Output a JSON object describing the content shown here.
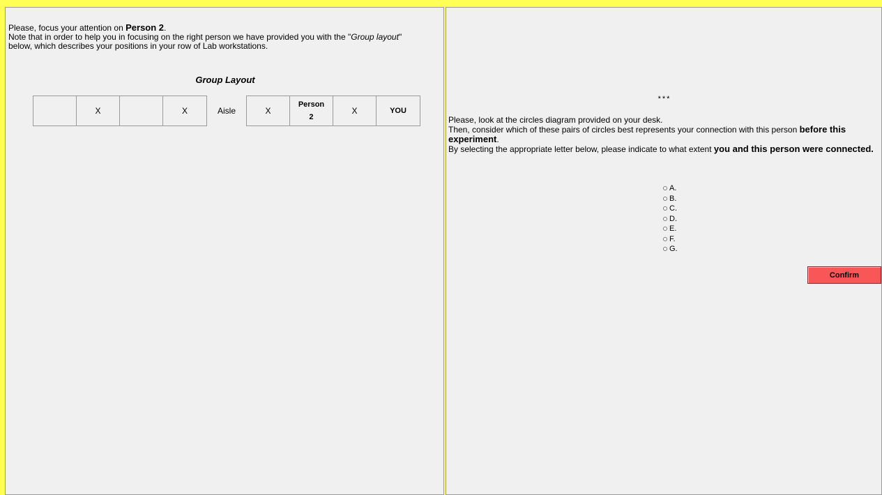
{
  "left": {
    "intro_line1_prefix": "Please, focus your attention on ",
    "intro_line1_person": "Person 2",
    "intro_line1_suffix": ".",
    "intro_line2_prefix": "Note that in order to help you in focusing on the right person we have provided you with the \"",
    "intro_line2_italic": "Group layout",
    "intro_line2_suffix": "\"",
    "intro_line3": "below, which describes your positions in your row of Lab workstations.",
    "group_title": "Group Layout",
    "left_cells": [
      "",
      "X",
      "",
      "X"
    ],
    "aisle_label": "Aisle",
    "right_cells": [
      {
        "text": "X",
        "bold": false
      },
      {
        "text": "Person\n2",
        "bold": true
      },
      {
        "text": "X",
        "bold": false
      },
      {
        "text": "YOU",
        "bold": true
      }
    ]
  },
  "right": {
    "stars": "***",
    "line1": "Please, look at the circles diagram provided on your desk.",
    "line2_prefix": "Then, consider which of these pairs of circles best represents your connection with this person ",
    "line2_bold": "before this experiment",
    "line2_suffix": ".",
    "line3_prefix": "By selecting the appropriate letter below, please indicate to what extent ",
    "line3_bold": "you and this person were connected.",
    "options": [
      "A.",
      "B.",
      "C.",
      "D.",
      "E.",
      "F.",
      "G."
    ],
    "confirm_label": "Confirm"
  },
  "colors": {
    "frame": "#ffff55",
    "panel": "#f0f0f0",
    "confirm": "#f95757"
  }
}
